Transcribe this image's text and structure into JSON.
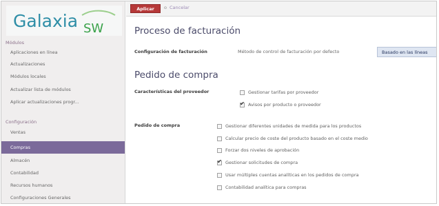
{
  "sidebar": {
    "logo_text": "Galaxia",
    "logo_suffix": "SW",
    "section_modules": "Módulos",
    "modules": [
      {
        "label": "Aplicaciones en línea"
      },
      {
        "label": "Actualizaciones"
      },
      {
        "label": "Módulos locales"
      },
      {
        "label": "Actualizar lista de módulos"
      },
      {
        "label": "Aplicar actualizaciones progr..."
      }
    ],
    "section_config": "Configuración",
    "config_items": [
      {
        "label": "Ventas"
      },
      {
        "label": "Compras",
        "active": true
      },
      {
        "label": "Almacén"
      },
      {
        "label": "Contabilidad"
      },
      {
        "label": "Recursos humanos"
      },
      {
        "label": "Configuraciones Generales"
      }
    ]
  },
  "toolbar": {
    "apply_label": "Aplicar",
    "or_text": "o",
    "cancel_label": "Cancelar"
  },
  "billing": {
    "title": "Proceso de facturación",
    "config_label": "Configuración de facturación",
    "method_label": "Método de control de facturación por defecto",
    "method_value": "Basado en las líneas"
  },
  "purchase": {
    "title": "Pedido de compra",
    "supplier_label": "Características del proveedor",
    "supplier_options": [
      {
        "label": "Gestionar tarifas por proveedor",
        "checked": false
      },
      {
        "label": "Avisos por producto o proveedor",
        "checked": true
      }
    ],
    "order_label": "Pedido de compra",
    "order_options": [
      {
        "label": "Gestionar diferentes unidades de medida para los productos",
        "checked": false
      },
      {
        "label": "Calcular precio de coste del producto basado en el coste medio",
        "checked": false
      },
      {
        "label": "Forzar dos niveles de aprobación",
        "checked": false
      },
      {
        "label": "Gestionar solicitudes de compra",
        "checked": true
      },
      {
        "label": "Usar múltiples cuentas analíticas en los pedidos de compra",
        "checked": false
      },
      {
        "label": "Contabilidad analítica para compras",
        "checked": false
      }
    ]
  },
  "colors": {
    "accent": "#7b6a9a",
    "apply_button": "#b63939",
    "select_bg": "#dfe6f2",
    "logo_green": "#3aa24a",
    "logo_teal": "#2f8ea7"
  }
}
